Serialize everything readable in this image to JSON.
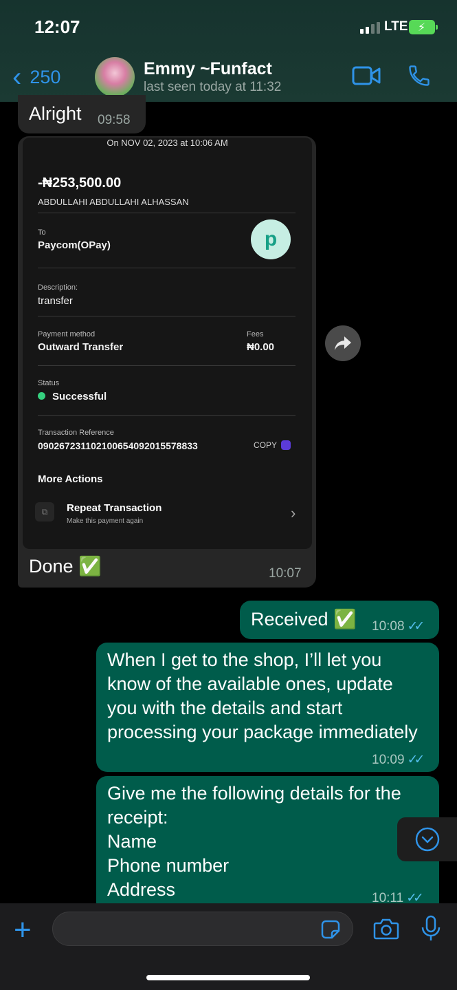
{
  "status_bar": {
    "time": "12:07",
    "network": "LTE"
  },
  "header": {
    "back_count": "250",
    "contact_name": "Emmy ~Funfact",
    "last_seen": "last seen today at 11:32"
  },
  "messages": {
    "alright": {
      "text": "Alright",
      "time": "09:58"
    },
    "done": {
      "text": "Done ✅",
      "time": "10:07"
    },
    "received": {
      "text": "Received ✅",
      "time": "10:08"
    },
    "shop": {
      "lines": [
        "When I get to the shop, I’ll let you",
        "know of the available ones, update",
        "you with the details and start",
        "processing your package immediately"
      ],
      "time": "10:09"
    },
    "details": {
      "lines": [
        "Give me the following details for the",
        "receipt:",
        "Name",
        "Phone number",
        "Address"
      ],
      "time": "10:11"
    }
  },
  "receipt": {
    "date": "On NOV 02, 2023 at 10:06 AM",
    "amount": "-₦253,500.00",
    "sender": "ABDULLAHI ABDULLAHI ALHASSAN",
    "to_label": "To",
    "to_value": "Paycom(OPay)",
    "logo_letter": "p",
    "description_label": "Description:",
    "description_value": "transfer",
    "method_label": "Payment method",
    "method_value": "Outward Transfer",
    "fees_label": "Fees",
    "fees_value": "₦0.00",
    "status_label": "Status",
    "status_value": "Successful",
    "reference_label": "Transaction Reference",
    "reference_value": "090267231102100654092015578833",
    "copy_label": "COPY",
    "more_actions": "More Actions",
    "repeat_title": "Repeat Transaction",
    "repeat_sub": "Make this payment again"
  },
  "colors": {
    "accent": "#2f93e8",
    "outgoing_bubble": "#005c4b",
    "incoming_bubble": "#262626",
    "read_ticks": "#53bdeb",
    "success": "#35d07f"
  }
}
